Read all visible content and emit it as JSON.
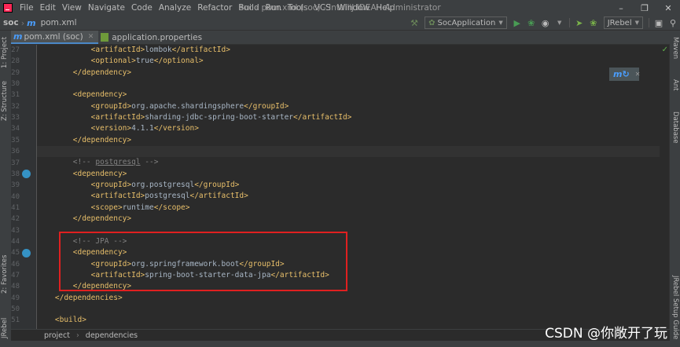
{
  "menubar": {
    "items": [
      "File",
      "Edit",
      "View",
      "Navigate",
      "Code",
      "Analyze",
      "Refactor",
      "Build",
      "Run",
      "Tools",
      "VCS",
      "Window",
      "Help"
    ],
    "title": "soc - pom.xml (soc) - IntelliJ IDEA - Administrator"
  },
  "navbar": {
    "project": "soc",
    "file": "pom.xml",
    "run_config": "SocApplication",
    "jrebel_config": "JRebel"
  },
  "tabs": [
    {
      "label": "pom.xml (soc)",
      "active": true
    },
    {
      "label": "application.properties",
      "active": false
    }
  ],
  "left_stripe": [
    "1: Project",
    "Z: Structure",
    "2: Favorites",
    "JRebel"
  ],
  "right_stripe": [
    "Maven",
    "Ant",
    "Database",
    "JRebel Setup Guide"
  ],
  "editor": {
    "lines": [
      {
        "n": "27",
        "indent": "            ",
        "parts": [
          [
            "tag",
            "<artifactId>"
          ],
          [
            "txt",
            "lombok"
          ],
          [
            "tag",
            "</artifactId>"
          ]
        ]
      },
      {
        "n": "28",
        "indent": "            ",
        "parts": [
          [
            "tag",
            "<optional>"
          ],
          [
            "txt",
            "true"
          ],
          [
            "tag",
            "</optional>"
          ]
        ]
      },
      {
        "n": "29",
        "indent": "        ",
        "parts": [
          [
            "tag",
            "</dependency>"
          ]
        ]
      },
      {
        "n": "30",
        "indent": "",
        "parts": []
      },
      {
        "n": "31",
        "indent": "        ",
        "parts": [
          [
            "tag",
            "<dependency>"
          ]
        ]
      },
      {
        "n": "32",
        "indent": "            ",
        "parts": [
          [
            "tag",
            "<groupId>"
          ],
          [
            "txt",
            "org.apache.shardingsphere"
          ],
          [
            "tag",
            "</groupId>"
          ]
        ]
      },
      {
        "n": "33",
        "indent": "            ",
        "parts": [
          [
            "tag",
            "<artifactId>"
          ],
          [
            "txt",
            "sharding-jdbc-spring-boot-starter"
          ],
          [
            "tag",
            "</artifactId>"
          ]
        ]
      },
      {
        "n": "34",
        "indent": "            ",
        "parts": [
          [
            "tag",
            "<version>"
          ],
          [
            "txt",
            "4.1.1"
          ],
          [
            "tag",
            "</version>"
          ]
        ]
      },
      {
        "n": "35",
        "indent": "        ",
        "parts": [
          [
            "tag",
            "</dependency>"
          ]
        ]
      },
      {
        "n": "36",
        "indent": "",
        "parts": [],
        "current": true
      },
      {
        "n": "37",
        "indent": "        ",
        "parts": [
          [
            "cmt",
            "<!-- "
          ],
          [
            "cmt-u",
            "postgresql"
          ],
          [
            "cmt",
            " -->"
          ]
        ]
      },
      {
        "n": "38",
        "indent": "        ",
        "parts": [
          [
            "tag",
            "<dependency>"
          ]
        ],
        "mark": true
      },
      {
        "n": "39",
        "indent": "            ",
        "parts": [
          [
            "tag",
            "<groupId>"
          ],
          [
            "txt",
            "org.postgresql"
          ],
          [
            "tag",
            "</groupId>"
          ]
        ]
      },
      {
        "n": "40",
        "indent": "            ",
        "parts": [
          [
            "tag",
            "<artifactId>"
          ],
          [
            "txt",
            "postgresql"
          ],
          [
            "tag",
            "</artifactId>"
          ]
        ]
      },
      {
        "n": "41",
        "indent": "            ",
        "parts": [
          [
            "tag",
            "<scope>"
          ],
          [
            "txt",
            "runtime"
          ],
          [
            "tag",
            "</scope>"
          ]
        ]
      },
      {
        "n": "42",
        "indent": "        ",
        "parts": [
          [
            "tag",
            "</dependency>"
          ]
        ]
      },
      {
        "n": "43",
        "indent": "",
        "parts": []
      },
      {
        "n": "44",
        "indent": "        ",
        "parts": [
          [
            "cmt",
            "<!-- JPA -->"
          ]
        ]
      },
      {
        "n": "45",
        "indent": "        ",
        "parts": [
          [
            "tag",
            "<dependency>"
          ]
        ],
        "mark": true
      },
      {
        "n": "46",
        "indent": "            ",
        "parts": [
          [
            "tag",
            "<groupId>"
          ],
          [
            "txt",
            "org.springframework.boot"
          ],
          [
            "tag",
            "</groupId>"
          ]
        ]
      },
      {
        "n": "47",
        "indent": "            ",
        "parts": [
          [
            "tag",
            "<artifactId>"
          ],
          [
            "txt",
            "spring-boot-starter-data-jpa"
          ],
          [
            "tag",
            "</artifactId>"
          ]
        ]
      },
      {
        "n": "48",
        "indent": "        ",
        "parts": [
          [
            "tag",
            "</dependency>"
          ]
        ]
      },
      {
        "n": "49",
        "indent": "    ",
        "parts": [
          [
            "tag",
            "</dependencies>"
          ]
        ]
      },
      {
        "n": "50",
        "indent": "",
        "parts": []
      },
      {
        "n": "51",
        "indent": "    ",
        "parts": [
          [
            "tag",
            "<build>"
          ]
        ]
      }
    ]
  },
  "breadcrumb": [
    "project",
    "dependencies"
  ],
  "watermark": "CSDN @你敞开了玩",
  "colors": {
    "tag": "#e8bf6a",
    "text": "#a9b7c6",
    "comment": "#808080",
    "highlight": "#e02020"
  }
}
